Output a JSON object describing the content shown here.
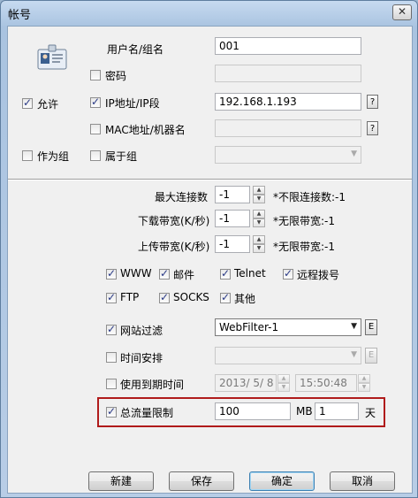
{
  "window": {
    "title": "帐号",
    "close_glyph": "✕"
  },
  "labels": {
    "username": "用户名/组名",
    "password": "密码",
    "allow": "允许",
    "ip": "IP地址/IP段",
    "mac": "MAC地址/机器名",
    "as_group": "作为组",
    "belongs_group": "属于组",
    "max_conn": "最大连接数",
    "download_bw": "下载带宽(K/秒)",
    "upload_bw": "上传带宽(K/秒)",
    "www": "WWW",
    "mail": "邮件",
    "telnet": "Telnet",
    "remote_dial": "远程拨号",
    "ftp": "FTP",
    "socks": "SOCKS",
    "other": "其他",
    "web_filter": "网站过滤",
    "schedule": "时间安排",
    "expiry": "使用到期时间",
    "total_traffic": "总流量限制",
    "mb": "MB",
    "day": "天"
  },
  "values": {
    "username": "001",
    "password": "",
    "ip": "192.168.1.193",
    "mac": "",
    "group": "",
    "max_conn": "-1",
    "download_bw": "-1",
    "upload_bw": "-1",
    "web_filter": "WebFilter-1",
    "schedule": "",
    "expiry_date": "2013/ 5/ 8",
    "expiry_time": "15:50:48",
    "traffic_mb": "100",
    "traffic_days": "1"
  },
  "hints": {
    "max_conn": "*不限连接数:-1",
    "download_bw": "*无限带宽:-1",
    "upload_bw": "*无限带宽:-1"
  },
  "checks": {
    "password": false,
    "allow": true,
    "ip": true,
    "mac": false,
    "as_group": false,
    "belongs_group": false,
    "www": true,
    "mail": true,
    "telnet": true,
    "remote_dial": true,
    "ftp": true,
    "socks": true,
    "other": true,
    "web_filter": true,
    "schedule": false,
    "expiry": false,
    "total_traffic": true
  },
  "glyphs": {
    "help": "?",
    "edit": "E",
    "up": "▲",
    "down": "▼",
    "dropdown": "▼"
  },
  "buttons": {
    "new": "新建",
    "save": "保存",
    "ok": "确定",
    "cancel": "取消"
  },
  "colors": {
    "highlight_border": "#b01b1b",
    "dialog_bg": "#f0f0f0"
  }
}
